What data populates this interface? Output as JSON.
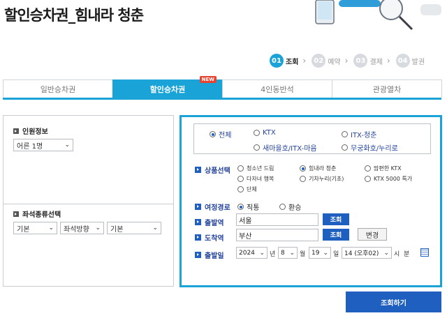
{
  "page": {
    "title": "할인승차권_힘내라 청춘"
  },
  "steps": [
    {
      "num": "01",
      "label": "조회",
      "active": true
    },
    {
      "num": "02",
      "label": "예약",
      "active": false
    },
    {
      "num": "03",
      "label": "결제",
      "active": false
    },
    {
      "num": "04",
      "label": "발권",
      "active": false
    }
  ],
  "tabs": [
    {
      "label": "일반승차권"
    },
    {
      "label": "할인승차권",
      "badge": "NEW"
    },
    {
      "label": "4인동반석"
    },
    {
      "label": "관광열차"
    }
  ],
  "left": {
    "passenger_title": "인원정보",
    "passenger_value": "어른 1명",
    "seat_title": "좌석종류선택",
    "seat_type": "기본",
    "seat_dir": "좌석방향",
    "seat_extra": "기본"
  },
  "trains": {
    "all": "전체",
    "ktx": "KTX",
    "itx_cheongchun": "ITX-청춘",
    "saemaeul": "새마을호/ITX-마음",
    "mugunghwa": "무궁화호/누리로"
  },
  "products": {
    "label": "상품선택",
    "items": [
      "청소년 드림",
      "힘내라 청춘",
      "맘편한 KTX",
      "다자녀 행복",
      "기차누리(기초)",
      "KTX 5000 특가",
      "단체"
    ]
  },
  "route": {
    "label": "여정경로",
    "direct": "직통",
    "transfer": "환승"
  },
  "departure": {
    "label": "출발역",
    "value": "서울",
    "search": "조회"
  },
  "arrival": {
    "label": "도착역",
    "value": "부산",
    "search": "조회",
    "swap": "변경"
  },
  "date": {
    "label": "출발일",
    "year": "2024",
    "year_unit": "년",
    "month": "8",
    "month_unit": "월",
    "day": "19",
    "day_unit": "일",
    "hour": "14 (오후02)",
    "hour_unit": "시",
    "minute_unit": "분"
  },
  "submit": "조회하기"
}
